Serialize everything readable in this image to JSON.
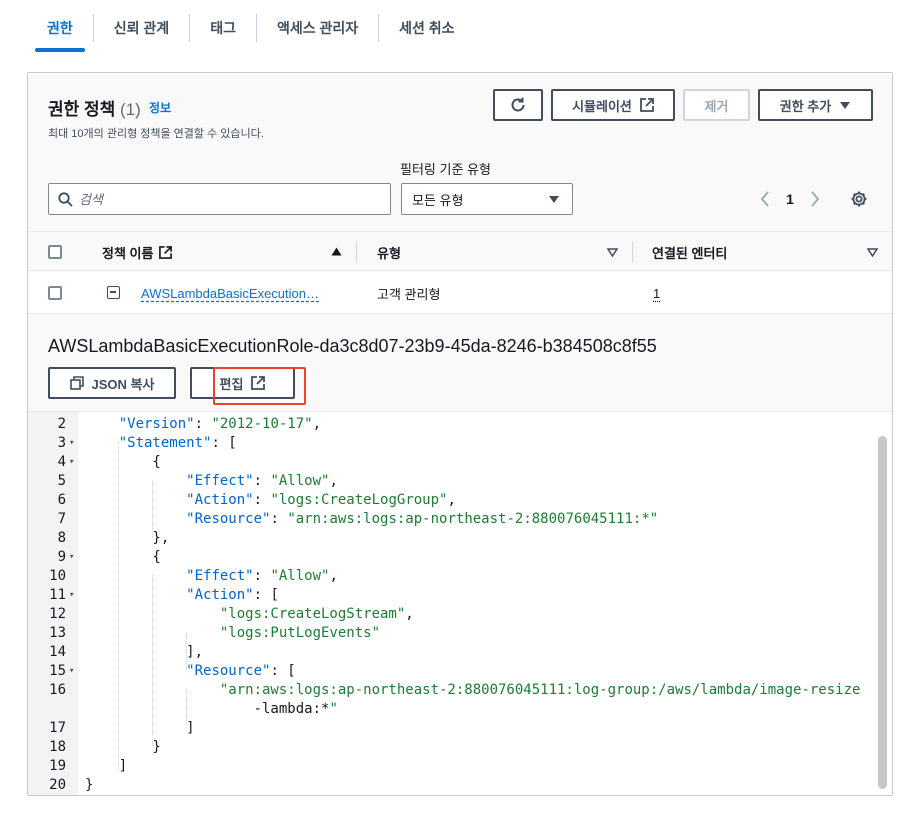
{
  "tabs": [
    {
      "label": "권한",
      "active": true
    },
    {
      "label": "신뢰 관계",
      "active": false
    },
    {
      "label": "태그",
      "active": false
    },
    {
      "label": "액세스 관리자",
      "active": false
    },
    {
      "label": "세션 취소",
      "active": false
    }
  ],
  "panel": {
    "title": "권한 정책",
    "count": "(1)",
    "info": "정보",
    "description": "최대 10개의 관리형 정책을 연결할 수 있습니다."
  },
  "buttons": {
    "refresh_icon": "refresh-icon",
    "simulate": "시뮬레이션",
    "remove": "제거",
    "add_permissions": "권한 추가"
  },
  "filter": {
    "search_placeholder": "검색",
    "type_label": "필터링 기준 유형",
    "type_value": "모든 유형"
  },
  "pagination": {
    "current": "1"
  },
  "table": {
    "columns": [
      "정책 이름",
      "유형",
      "연결된 엔터티"
    ],
    "rows": [
      {
        "name": "AWSLambdaBasicExecution…",
        "type": "고객 관리형",
        "entities": "1"
      }
    ]
  },
  "detail": {
    "title": "AWSLambdaBasicExecutionRole-da3c8d07-23b9-45da-8246-b384508c8f55",
    "copy_json": "JSON 복사",
    "edit": "편집"
  },
  "code": {
    "lines": [
      {
        "n": "2",
        "fold": false,
        "text": "    \"Version\": \"2012-10-17\","
      },
      {
        "n": "3",
        "fold": true,
        "text": "    \"Statement\": ["
      },
      {
        "n": "4",
        "fold": true,
        "text": "        {"
      },
      {
        "n": "5",
        "fold": false,
        "text": "            \"Effect\": \"Allow\","
      },
      {
        "n": "6",
        "fold": false,
        "text": "            \"Action\": \"logs:CreateLogGroup\","
      },
      {
        "n": "7",
        "fold": false,
        "text": "            \"Resource\": \"arn:aws:logs:ap-northeast-2:880076045111:*\""
      },
      {
        "n": "8",
        "fold": false,
        "text": "        },"
      },
      {
        "n": "9",
        "fold": true,
        "text": "        {"
      },
      {
        "n": "10",
        "fold": false,
        "text": "            \"Effect\": \"Allow\","
      },
      {
        "n": "11",
        "fold": true,
        "text": "            \"Action\": ["
      },
      {
        "n": "12",
        "fold": false,
        "text": "                \"logs:CreateLogStream\","
      },
      {
        "n": "13",
        "fold": false,
        "text": "                \"logs:PutLogEvents\""
      },
      {
        "n": "14",
        "fold": false,
        "text": "            ],"
      },
      {
        "n": "15",
        "fold": true,
        "text": "            \"Resource\": ["
      },
      {
        "n": "16",
        "fold": false,
        "text": "                \"arn:aws:logs:ap-northeast-2:880076045111:log-group:/aws/lambda/image-resize"
      },
      {
        "n": "",
        "fold": false,
        "text": "                    -lambda:*\""
      },
      {
        "n": "17",
        "fold": false,
        "text": "            ]"
      },
      {
        "n": "18",
        "fold": false,
        "text": "        }"
      },
      {
        "n": "19",
        "fold": false,
        "text": "    ]"
      },
      {
        "n": "20",
        "fold": false,
        "text": "}"
      }
    ]
  },
  "colors": {
    "accent": "#0972d3",
    "highlight": "#e8442b",
    "string": "#1e7b34",
    "key": "#0064c8"
  }
}
